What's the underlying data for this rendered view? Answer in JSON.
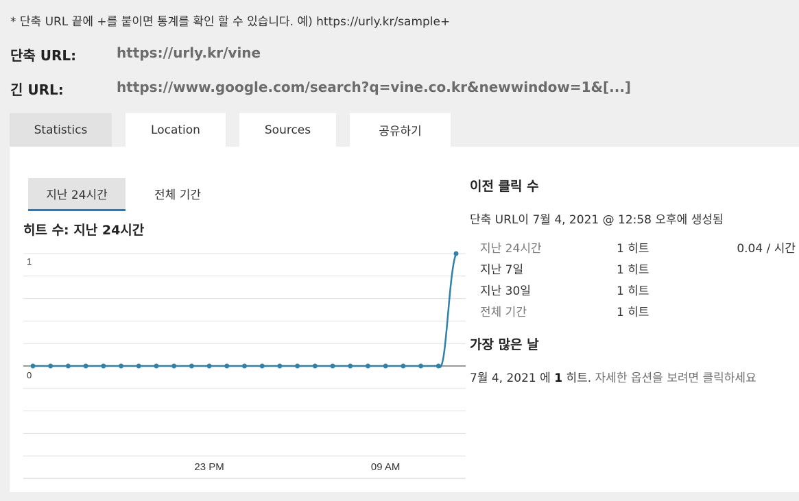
{
  "note": "* 단축 URL 끝에 +를 붙이면 통계를 확인 할 수 있습니다. 예) https://urly.kr/sample+",
  "short_url": {
    "label": "단축 URL:",
    "value": "https://urly.kr/vine"
  },
  "long_url": {
    "label": "긴 URL:",
    "value": "https://www.google.com/search?q=vine.co.kr&newwindow=1&[...]"
  },
  "tabs": [
    {
      "label": "Statistics",
      "active": true
    },
    {
      "label": "Location",
      "active": false
    },
    {
      "label": "Sources",
      "active": false
    },
    {
      "label": "공유하기",
      "active": false
    }
  ],
  "subtabs": [
    {
      "label": "지난 24시간",
      "active": true
    },
    {
      "label": "전체 기간",
      "active": false
    }
  ],
  "chart_title": "히트 수: 지난 24시간",
  "chart_data": {
    "type": "line",
    "title": "히트 수: 지난 24시간",
    "xlabel": "",
    "ylabel": "",
    "ylim": [
      0,
      1
    ],
    "ytick_labels": [
      "1",
      "0"
    ],
    "xtick_labels": [
      "23 PM",
      "09 AM"
    ],
    "x_tick_indices": [
      10,
      20
    ],
    "series": [
      {
        "values": [
          0,
          0,
          0,
          0,
          0,
          0,
          0,
          0,
          0,
          0,
          0,
          0,
          0,
          0,
          0,
          0,
          0,
          0,
          0,
          0,
          0,
          0,
          0,
          0,
          1
        ]
      }
    ],
    "color": "#2e81aa",
    "grid": true
  },
  "right": {
    "previous_clicks_title": "이전 클릭 수",
    "created": "단축 URL이 7월 4, 2021 @ 12:58 오후에 생성됨",
    "stats": [
      {
        "period": "지난 24시간",
        "hits": "1 히트",
        "rate": "0.04 / 시간",
        "muted": true
      },
      {
        "period": "지난 7일",
        "hits": "1 히트",
        "rate": "",
        "muted": false
      },
      {
        "period": "지난 30일",
        "hits": "1 히트",
        "rate": "",
        "muted": false
      },
      {
        "period": "전체 기간",
        "hits": "1 히트",
        "rate": "",
        "muted": true
      }
    ],
    "best_day_title": "가장 많은 날",
    "best_day": {
      "date": "7월 4, 2021",
      "mid": " 에 ",
      "count": "1",
      "suffix": " 히트.",
      "link": " 자세한 옵션을 보려면 클릭하세요"
    }
  }
}
